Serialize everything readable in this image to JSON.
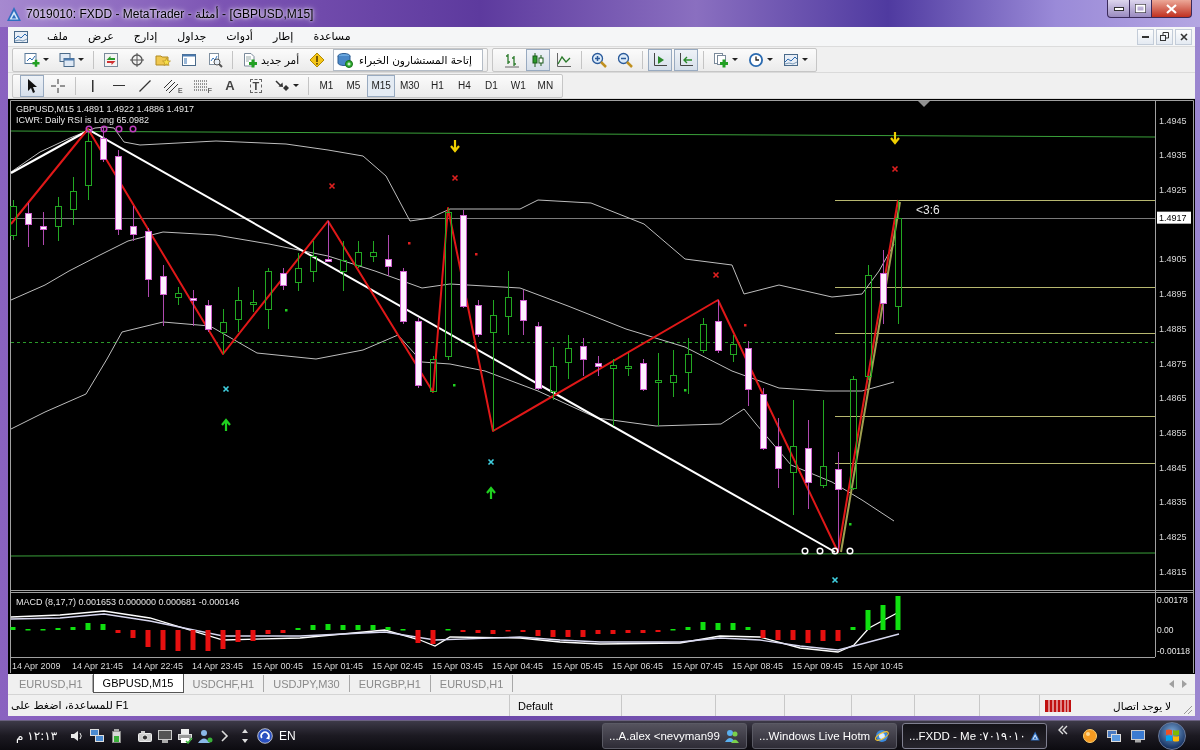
{
  "window": {
    "title": "7019010: FXDD - MetaTrader - أمثلة - [GBPUSD,M15]"
  },
  "menu": [
    "مساعدة",
    "إطار",
    "أدوات",
    "جداول",
    "إدارج",
    "عرض",
    "ملف"
  ],
  "toolbar": {
    "new_order": "أمر جديد",
    "expert_advisors": "إتاحة المستشارون الخبراء",
    "chart_types": [
      {
        "kind": "bars",
        "selected": false
      },
      {
        "kind": "candles",
        "selected": true
      },
      {
        "kind": "line",
        "selected": false
      }
    ],
    "chart_shift": {
      "on": true
    },
    "auto_scroll": {
      "on": true
    }
  },
  "drawing_toolbar": {
    "tools": [
      {
        "kind": "cursor",
        "selected": true
      },
      {
        "kind": "crosshair",
        "selected": false
      },
      {
        "kind": "vline",
        "selected": false
      },
      {
        "kind": "hline",
        "selected": false
      },
      {
        "kind": "trendline",
        "selected": false
      },
      {
        "kind": "fibo_channel",
        "selected": false,
        "glyph": "E"
      },
      {
        "kind": "fibo",
        "selected": false,
        "glyph": "F"
      },
      {
        "kind": "text",
        "selected": false,
        "glyph": "A"
      },
      {
        "kind": "label",
        "selected": false,
        "glyph": "T"
      },
      {
        "kind": "arrows",
        "selected": false
      }
    ],
    "timeframes": [
      {
        "label": "M1",
        "selected": false
      },
      {
        "label": "M5",
        "selected": false
      },
      {
        "label": "M15",
        "selected": true
      },
      {
        "label": "M30",
        "selected": false
      },
      {
        "label": "H1",
        "selected": false
      },
      {
        "label": "H4",
        "selected": false
      },
      {
        "label": "D1",
        "selected": false
      },
      {
        "label": "W1",
        "selected": false
      },
      {
        "label": "MN",
        "selected": false
      }
    ]
  },
  "chart": {
    "header": "GBPUSD,M15 1.4891 1.4922 1.4886 1.4917",
    "indicator_text": "ICWR: Daily RSI is Long 65.0982",
    "pattern_label": "<3:6",
    "price_axis": [
      {
        "kind": "tick",
        "label": "1.4945"
      },
      {
        "kind": "tick",
        "label": "1.4935"
      },
      {
        "kind": "tick",
        "label": "1.4925"
      },
      {
        "kind": "current",
        "label": "1.4917"
      },
      {
        "kind": "tick",
        "label": "1.4905"
      },
      {
        "kind": "tick",
        "label": "1.4895"
      },
      {
        "kind": "tick",
        "label": "1.4885"
      },
      {
        "kind": "tick",
        "label": "1.4875"
      },
      {
        "kind": "tick",
        "label": "1.4865"
      },
      {
        "kind": "tick",
        "label": "1.4855"
      },
      {
        "kind": "tick",
        "label": "1.4845"
      },
      {
        "kind": "tick",
        "label": "1.4835"
      },
      {
        "kind": "tick",
        "label": "1.4825"
      },
      {
        "kind": "tick",
        "label": "1.4815"
      }
    ],
    "macd": {
      "header": "MACD (8,17,7) 0.001653 0.000000 0.000681 -0.000146",
      "labels": [
        "0.00178",
        "0.00",
        "-0.00118"
      ]
    },
    "time_axis": [
      "14 Apr 2009",
      "14 Apr 21:45",
      "14 Apr 22:45",
      "14 Apr 23:45",
      "15 Apr 00:45",
      "15 Apr 01:45",
      "15 Apr 02:45",
      "15 Apr 03:45",
      "15 Apr 04:45",
      "15 Apr 05:45",
      "15 Apr 06:45",
      "15 Apr 07:45",
      "15 Apr 08:45",
      "15 Apr 09:45",
      "15 Apr 10:45"
    ]
  },
  "chart_tabs": [
    {
      "label": "EURUSD,H1",
      "selected": false
    },
    {
      "label": "GBPUSD,M15",
      "selected": true
    },
    {
      "label": "USDCHF,H1",
      "selected": false
    },
    {
      "label": "USDJPY,M30",
      "selected": false
    },
    {
      "label": "EURGBP,H1",
      "selected": false
    },
    {
      "label": "EURUSD,H1",
      "selected": false
    }
  ],
  "status_bar": {
    "help": "للمساعدة، اضغط على F1",
    "profile": "Default",
    "connection": "لا يوجد اتصال"
  },
  "taskbar": {
    "clock": "١٢:١٣ م",
    "language": "EN",
    "windows": [
      {
        "kind": "messenger",
        "label": "...A.alex <nevyman99",
        "selected": false
      },
      {
        "kind": "browser",
        "label": "...Windows Live Hotm",
        "selected": false
      },
      {
        "kind": "terminal",
        "label": "...FXDD - Me :٧٠١٩٠١٠",
        "selected": true
      }
    ]
  }
}
